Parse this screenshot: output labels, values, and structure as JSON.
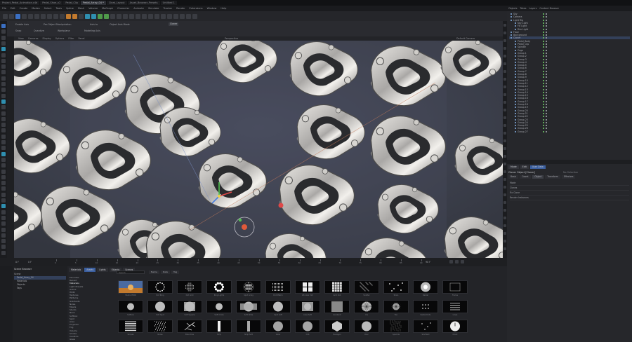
{
  "tabs": [
    "Project_Pedal_Animation.c4d",
    "Pedal_Shoe_v2",
    "Pedal_Clip",
    "Pedal_Array_04 *",
    "Cleat_Layout",
    "Asset_Browser_Presets",
    "Untitled 1"
  ],
  "active_tab_index": 3,
  "menu": [
    "File",
    "Edit",
    "Create",
    "Modes",
    "Select",
    "Tools",
    "Spline",
    "Mesh",
    "Volume",
    "MoGraph",
    "Character",
    "Animate",
    "Simulate",
    "Tracker",
    "Render",
    "Extensions",
    "Window",
    "Help"
  ],
  "attributes": {
    "row1": [
      "Enable Axis",
      "Per-Object Manipulation",
      "Axis to",
      "Object Axis Mode"
    ],
    "row2": [
      "Snap",
      "Quantize",
      "Workplane",
      "Modeling Axis"
    ],
    "selected_object": "Cloner"
  },
  "viewport": {
    "menu": [
      "View",
      "Cameras",
      "Display",
      "Options",
      "Filter",
      "Panel"
    ],
    "label": "Perspective",
    "camera": "Default Camera"
  },
  "timeline": {
    "start": "0 F",
    "end": "90 F",
    "current": "0 F",
    "ticks": [
      "0",
      "5",
      "10",
      "15",
      "20",
      "25",
      "30",
      "35",
      "40",
      "45",
      "50",
      "55",
      "60",
      "65",
      "70",
      "75",
      "80",
      "85",
      "90"
    ]
  },
  "right_panel": {
    "tabs": [
      "Objects",
      "Takes",
      "Layers",
      "Content Browser"
    ],
    "objects": [
      {
        "name": "Sky",
        "level": 0
      },
      {
        "name": "Camera",
        "level": 0
      },
      {
        "name": "Light Rig",
        "level": 0
      },
      {
        "name": "Key Light",
        "level": 1
      },
      {
        "name": "Fill Light",
        "level": 1
      },
      {
        "name": "Rim Light",
        "level": 1
      },
      {
        "name": "Floor",
        "level": 0
      },
      {
        "name": "Background",
        "level": 0
      },
      {
        "name": "Cloner",
        "level": 0
      },
      {
        "name": "Pedal_Body",
        "level": 1
      },
      {
        "name": "Pedal_Clip",
        "level": 1
      },
      {
        "name": "Spindle",
        "level": 1
      },
      {
        "name": "Cage",
        "level": 1
      },
      {
        "name": "Group.1",
        "level": 1
      },
      {
        "name": "Group.2",
        "level": 1
      },
      {
        "name": "Group.3",
        "level": 1
      },
      {
        "name": "Group.4",
        "level": 1
      },
      {
        "name": "Group.5",
        "level": 1
      },
      {
        "name": "Group.6",
        "level": 1
      },
      {
        "name": "Group.7",
        "level": 1
      },
      {
        "name": "Group.8",
        "level": 1
      },
      {
        "name": "Group.9",
        "level": 1
      },
      {
        "name": "Group.10",
        "level": 1
      },
      {
        "name": "Group.11",
        "level": 1
      },
      {
        "name": "Group.12",
        "level": 1
      },
      {
        "name": "Group.13",
        "level": 1
      },
      {
        "name": "Group.14",
        "level": 1
      },
      {
        "name": "Group.15",
        "level": 1
      },
      {
        "name": "Group.16",
        "level": 1
      },
      {
        "name": "Group.17",
        "level": 1
      },
      {
        "name": "Group.18",
        "level": 1
      },
      {
        "name": "Group.19",
        "level": 1
      },
      {
        "name": "Group.20",
        "level": 1
      },
      {
        "name": "Group.21",
        "level": 1
      },
      {
        "name": "Group.22",
        "level": 1
      },
      {
        "name": "Group.23",
        "level": 1
      },
      {
        "name": "Group.24",
        "level": 1
      },
      {
        "name": "Group.25",
        "level": 1
      },
      {
        "name": "Group.26",
        "level": 1
      },
      {
        "name": "Group.27",
        "level": 1
      }
    ],
    "attribute_tabs": [
      "Mode",
      "Edit",
      "User Data"
    ],
    "attribute_title": "Cloner Object [Cloner]",
    "attribute_sections": [
      "Basic",
      "Coord.",
      "Object",
      "Transform",
      "Effectors"
    ],
    "attribute_rows": [
      "Mode",
      "Clones",
      "Fix Clone",
      "Render Instances"
    ],
    "right_placeholder": "No Selection"
  },
  "asset_browser": {
    "left_title": "Scene Browser",
    "left_items": [
      "Scene",
      "Pedal_Array_04",
      "Materials",
      "Objects",
      "Tags"
    ],
    "tabs": [
      "Materials",
      "Assets",
      "Lights",
      "Objects",
      "Scenes"
    ],
    "search_placeholder": "Search",
    "filter_labels": [
      "Name",
      "Date",
      "Tag"
    ],
    "folders": [
      "Favorites",
      "Recent",
      "Materials",
      "Light Presets",
      "Gobos",
      "HDRI",
      "Textures",
      "Patterns",
      "Gradients",
      "Noise",
      "Masks",
      "Studio",
      "Neon",
      "Softbox",
      "Spot",
      "Area",
      "Projector",
      "Fog",
      "Volume",
      "Smoke",
      "Caustics",
      "Glass"
    ],
    "thumbnails_row1": [
      "Studio HDRI",
      "Dot Ring",
      "Dot Grid",
      "Ring Lights",
      "Spot Array",
      "Dot Matrix",
      "Window 2x2",
      "Grid 4x4",
      "Scatter",
      "Stars",
      "Radial",
      "Frame"
    ],
    "thumbnails_row2": [
      "Softbox",
      "Soft Spot",
      "Soft Square",
      "Soft Circle",
      "Soft Wide",
      "Spot Soft",
      "Area Soft",
      "Gradient",
      "Iris",
      "Fan",
      "Radial Dots",
      "Lines"
    ],
    "thumbnails_row3": [
      "Stripes",
      "Noise",
      "Branches",
      "Strip",
      "Strip Soft",
      "Glow",
      "Orb",
      "Hexagon",
      "Disc",
      "Speckle",
      "Starfield",
      "Clock"
    ]
  }
}
